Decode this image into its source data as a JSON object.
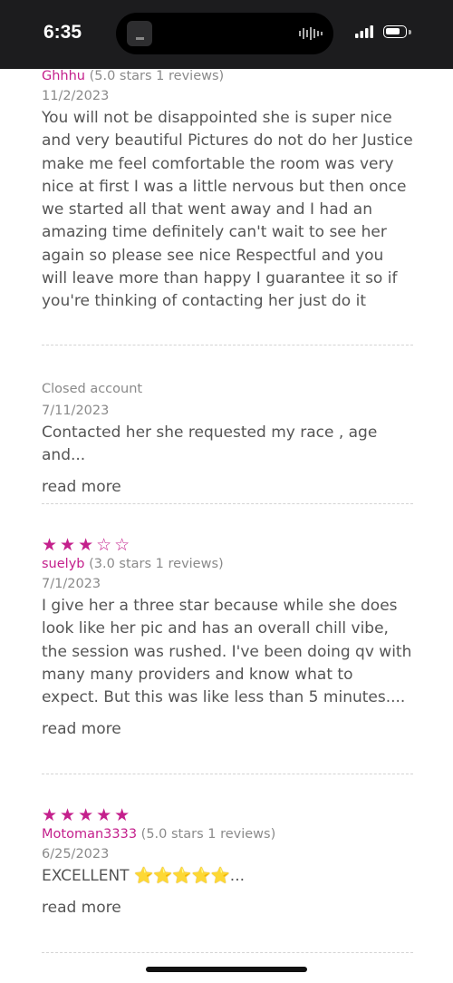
{
  "status_bar": {
    "time": "6:35"
  },
  "reviews": [
    {
      "username": "Ghhhu",
      "rating_text": "(5.0 stars 1 reviews)",
      "date": "11/2/2023",
      "body": "You will not be disappointed she is super nice and very beautiful Pictures do not do her Justice make me feel comfortable the room was very nice at first I was a little nervous but then once we started all that went away and I had an amazing time definitely can't wait to see her again so please see nice Respectful and you will leave more than happy I guarantee it so if you're thinking of contacting her just do it"
    },
    {
      "author": "Closed account",
      "date": "7/11/2023",
      "body": "Contacted her she requested my race , age and...",
      "read_more": "read more"
    },
    {
      "stars": "★★★☆☆",
      "rating": 3,
      "username": "suelyb",
      "rating_text": "(3.0 stars 1 reviews)",
      "date": "7/1/2023",
      "body": "I give her a three star because while she does look like her pic and has an overall chill vibe, the session was rushed. I've been doing qv with many many providers and know what to expect. But this was like less than 5 minutes....",
      "read_more": "read more"
    },
    {
      "stars": "★★★★★",
      "rating": 5,
      "username": "Motoman3333",
      "rating_text": "(5.0 stars 1 reviews)",
      "date": "6/25/2023",
      "body_prefix": "EXCELLENT ",
      "body_emoji": "⭐⭐⭐⭐⭐",
      "body_suffix": "...",
      "read_more": "read more"
    }
  ],
  "colors": {
    "accent": "#c4208c",
    "text": "#555555",
    "muted": "#8a8a8a"
  }
}
